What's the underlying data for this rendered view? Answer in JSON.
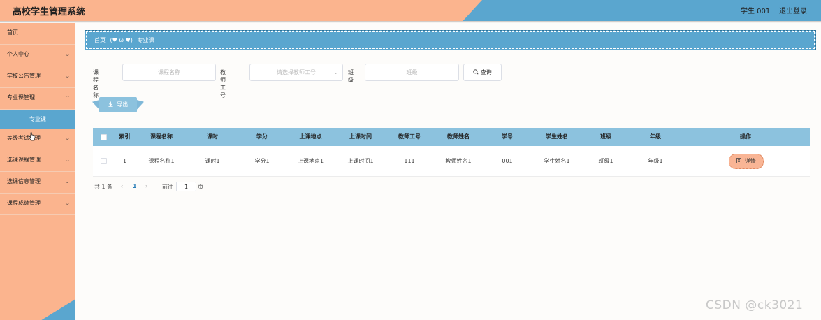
{
  "app": {
    "title": "高校学生管理系统",
    "user": "学生 001",
    "logout": "退出登录"
  },
  "sidebar": {
    "items": [
      {
        "label": "首页",
        "has_chevron": false
      },
      {
        "label": "个人中心",
        "has_chevron": true
      },
      {
        "label": "学校公告管理",
        "has_chevron": true
      },
      {
        "label": "专业课管理",
        "has_chevron": true
      },
      {
        "label": "等级考试管理",
        "has_chevron": true
      },
      {
        "label": "选课课程管理",
        "has_chevron": true
      },
      {
        "label": "选课信息管理",
        "has_chevron": true
      },
      {
        "label": "课程成绩管理",
        "has_chevron": true
      }
    ],
    "active_sub": "专业课",
    "chevron_glyph": "⌄"
  },
  "breadcrumb": {
    "home": "首页",
    "emoticon": "(♥ ω ♥)",
    "current": "专业课"
  },
  "search": {
    "course_name_label": "课程名称",
    "course_name_placeholder": "课程名称",
    "teacher_id_label": "教师工号",
    "teacher_id_placeholder": "请选择教师工号",
    "class_label": "班级",
    "class_placeholder": "班级",
    "query_button": "查询"
  },
  "toolbar": {
    "export_button": "导出"
  },
  "table": {
    "headers": [
      "索引",
      "课程名称",
      "课时",
      "学分",
      "上课地点",
      "上课时间",
      "教师工号",
      "教师姓名",
      "学号",
      "学生姓名",
      "班级",
      "年级",
      "操作"
    ],
    "rows": [
      {
        "cells": [
          "1",
          "课程名称1",
          "课时1",
          "学分1",
          "上课地点1",
          "上课时间1",
          "111",
          "教师姓名1",
          "001",
          "学生姓名1",
          "班级1",
          "年级1"
        ],
        "action": "详情"
      }
    ]
  },
  "pagination": {
    "total": "共 1 条",
    "prev": "‹",
    "current_page": "1",
    "next": "›",
    "goto_label": "前往",
    "goto_value": "1",
    "page_suffix": "页"
  },
  "watermark": "CSDN @ck3021",
  "colors": {
    "peach": "#fbb48e",
    "blue": "#5aa6cf",
    "table_header": "#8cc2de",
    "detail_button": "#f9b595",
    "page_active": "#2b7fb8"
  }
}
